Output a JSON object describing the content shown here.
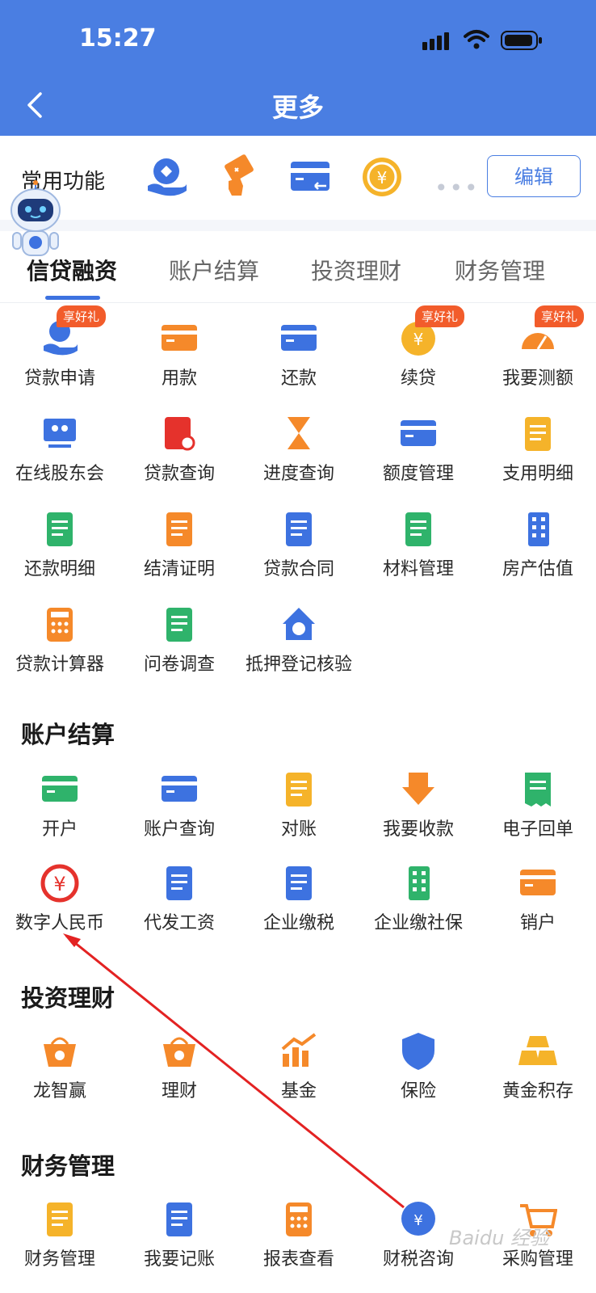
{
  "status_bar": {
    "time": "15:27"
  },
  "header": {
    "title": "更多"
  },
  "quick": {
    "label": "常用功能",
    "icons": [
      "loan-apply-icon",
      "use-funds-icon",
      "repay-card-icon",
      "renew-loan-icon"
    ],
    "more": "•••",
    "edit_label": "编辑"
  },
  "tabs": [
    "信贷融资",
    "账户结算",
    "投资理财",
    "财务管理"
  ],
  "credit": [
    {
      "label": "贷款申请",
      "badge": "享好礼"
    },
    {
      "label": "用款",
      "badge": ""
    },
    {
      "label": "还款",
      "badge": ""
    },
    {
      "label": "续贷",
      "badge": "享好礼"
    },
    {
      "label": "我要测额",
      "badge": "享好礼"
    },
    {
      "label": "在线股东会",
      "badge": ""
    },
    {
      "label": "贷款查询",
      "badge": ""
    },
    {
      "label": "进度查询",
      "badge": ""
    },
    {
      "label": "额度管理",
      "badge": ""
    },
    {
      "label": "支用明细",
      "badge": ""
    },
    {
      "label": "还款明细",
      "badge": ""
    },
    {
      "label": "结清证明",
      "badge": ""
    },
    {
      "label": "贷款合同",
      "badge": ""
    },
    {
      "label": "材料管理",
      "badge": ""
    },
    {
      "label": "房产估值",
      "badge": ""
    },
    {
      "label": "贷款计算器",
      "badge": ""
    },
    {
      "label": "问卷调查",
      "badge": ""
    },
    {
      "label": "抵押登记核验",
      "badge": ""
    }
  ],
  "account": {
    "title": "账户结算",
    "items": [
      "开户",
      "账户查询",
      "对账",
      "我要收款",
      "电子回单",
      "数字人民币",
      "代发工资",
      "企业缴税",
      "企业缴社保",
      "销户"
    ]
  },
  "invest": {
    "title": "投资理财",
    "items": [
      "龙智赢",
      "理财",
      "基金",
      "保险",
      "黄金积存"
    ]
  },
  "finance": {
    "title": "财务管理",
    "items": [
      "财务管理",
      "我要记账",
      "报表查看",
      "财税咨询",
      "采购管理"
    ]
  },
  "colors": {
    "header": "#4a7ee2",
    "accent": "#3d72e0",
    "orange": "#f5892a",
    "green": "#2fb36b",
    "badge": "#f25c2b",
    "red": "#e5322c"
  },
  "watermark": "Baidu 经验"
}
